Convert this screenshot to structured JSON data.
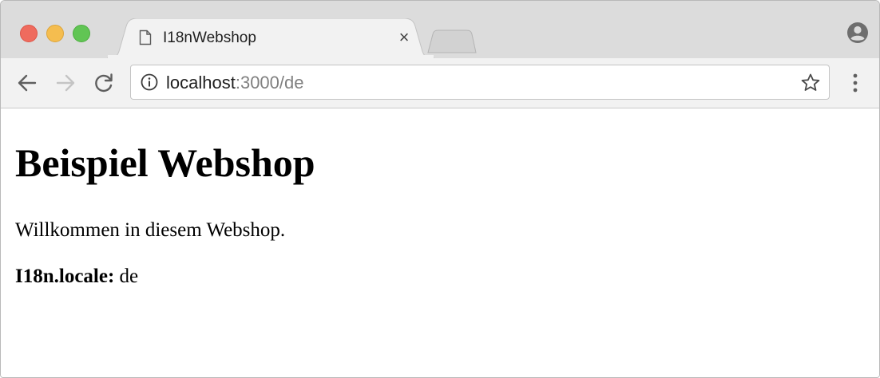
{
  "browser": {
    "tab": {
      "title": "I18nWebshop",
      "close_glyph": "×",
      "icon": "page-icon"
    },
    "new_tab_icon": "new-tab-icon",
    "profile_icon": "profile-icon",
    "nav": {
      "back_icon": "back-arrow-icon",
      "forward_icon": "forward-arrow-icon",
      "reload_icon": "reload-icon"
    },
    "address_bar": {
      "host": "localhost",
      "rest": ":3000/de",
      "info_icon": "info-icon",
      "bookmark_icon": "star-icon"
    },
    "menu_icon": "kebab-menu-icon",
    "traffic_lights": {
      "close_color": "#ef6b5e",
      "minimize_color": "#f5bd4f",
      "maximize_color": "#61c554"
    }
  },
  "page": {
    "heading": "Beispiel Webshop",
    "welcome_text": "Willkommen in diesem Webshop.",
    "locale_label": "I18n.locale:",
    "locale_value": "de"
  }
}
